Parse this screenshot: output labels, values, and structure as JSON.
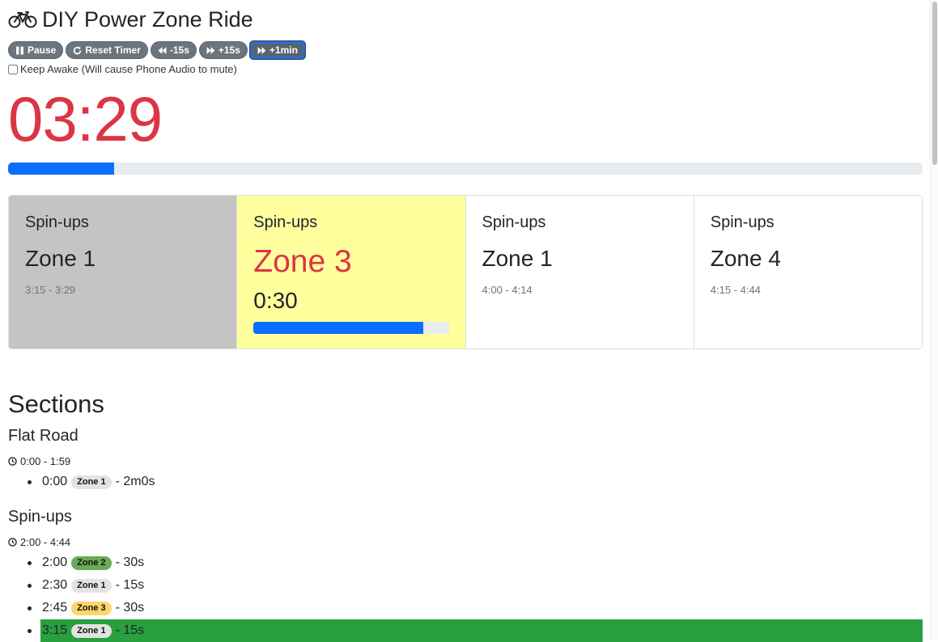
{
  "header": {
    "title": "DIY Power Zone Ride"
  },
  "controls": {
    "pause": "Pause",
    "reset": "Reset Timer",
    "back15": "-15s",
    "fwd15": "+15s",
    "fwd1min": "+1min"
  },
  "keep_awake": {
    "label": "Keep Awake (Will cause Phone Audio to mute)",
    "checked": false
  },
  "timer": {
    "value": "03:29",
    "progress": 0.116
  },
  "cards": [
    {
      "section": "Spin-ups",
      "zone": "Zone 1",
      "range": "3:15 - 3:29",
      "state": "past"
    },
    {
      "section": "Spin-ups",
      "zone": "Zone 3",
      "remaining": "0:30",
      "progress": 0.87,
      "state": "current"
    },
    {
      "section": "Spin-ups",
      "zone": "Zone 1",
      "range": "4:00 - 4:14",
      "state": "upcoming"
    },
    {
      "section": "Spin-ups",
      "zone": "Zone 4",
      "range": "4:15 - 4:44",
      "state": "upcoming"
    }
  ],
  "sections_title": "Sections",
  "sections": [
    {
      "name": "Flat Road",
      "range": "0:00 - 1:59",
      "intervals": [
        {
          "start": "0:00",
          "zone": "Zone 1",
          "duration": "- 2m0s"
        }
      ]
    },
    {
      "name": "Spin-ups",
      "range": "2:00 - 4:44",
      "intervals": [
        {
          "start": "2:00",
          "zone": "Zone 2",
          "duration": "- 30s"
        },
        {
          "start": "2:30",
          "zone": "Zone 1",
          "duration": "- 15s"
        },
        {
          "start": "2:45",
          "zone": "Zone 3",
          "duration": "- 30s"
        },
        {
          "start": "3:15",
          "zone": "Zone 1",
          "duration": "- 15s"
        }
      ]
    }
  ],
  "colors": {
    "timer": "#dc3545",
    "progress": "#0d6efd",
    "current_card": "#ffff9e",
    "past_card": "#c4c4c4",
    "active_interval": "#28a03d",
    "zone1": "#e3e3e3",
    "zone2": "#6aaa58",
    "zone3": "#ffd56a"
  }
}
